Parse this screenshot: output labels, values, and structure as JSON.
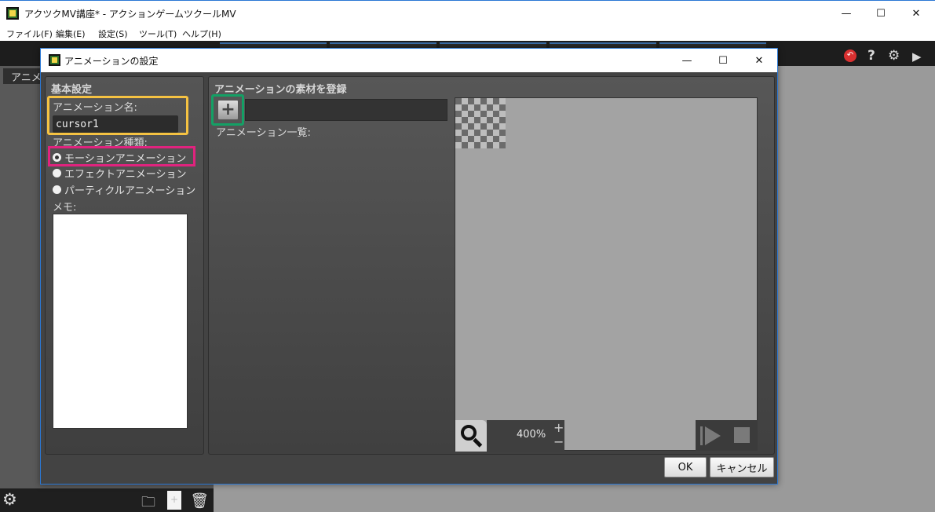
{
  "window": {
    "title": "アクツクMV講座* - アクションゲームツクールMV",
    "minimize": "—",
    "maximize": "☐",
    "close": "✕"
  },
  "menu": [
    "ファイル(F)",
    "編集(E)",
    "設定(S)",
    "ツール(T)",
    "ヘルプ(H)"
  ],
  "main": {
    "left_tab": "アニメ",
    "toolbar_icons": [
      "undo-icon",
      "help-icon",
      "gear-icon",
      "play-icon"
    ],
    "bottom_icons": [
      "gear-icon",
      "add-folder-icon",
      "new-file-icon",
      "trash-icon"
    ]
  },
  "dialog": {
    "title": "アニメーションの設定",
    "basic": {
      "heading": "基本設定",
      "name_label": "アニメーション名:",
      "name_value": "cursor1",
      "type_label": "アニメーション種類:",
      "types": [
        {
          "label": "モーションアニメーション",
          "selected": true
        },
        {
          "label": "エフェクトアニメーション",
          "selected": false
        },
        {
          "label": "パーティクルアニメーション",
          "selected": false
        }
      ],
      "memo_label": "メモ:",
      "memo_value": ""
    },
    "material": {
      "heading": "アニメーションの素材を登録",
      "add_button": "+",
      "list_label": "アニメーション一覧:",
      "zoom": "400%",
      "zoom_plus": "+",
      "zoom_minus": "−"
    },
    "ok": "OK",
    "cancel": "キャンセル"
  },
  "colors": {
    "highlight_name": "#f5c242",
    "highlight_type": "#e0237e",
    "highlight_add": "#14a065",
    "window_border": "#2b78d4"
  }
}
